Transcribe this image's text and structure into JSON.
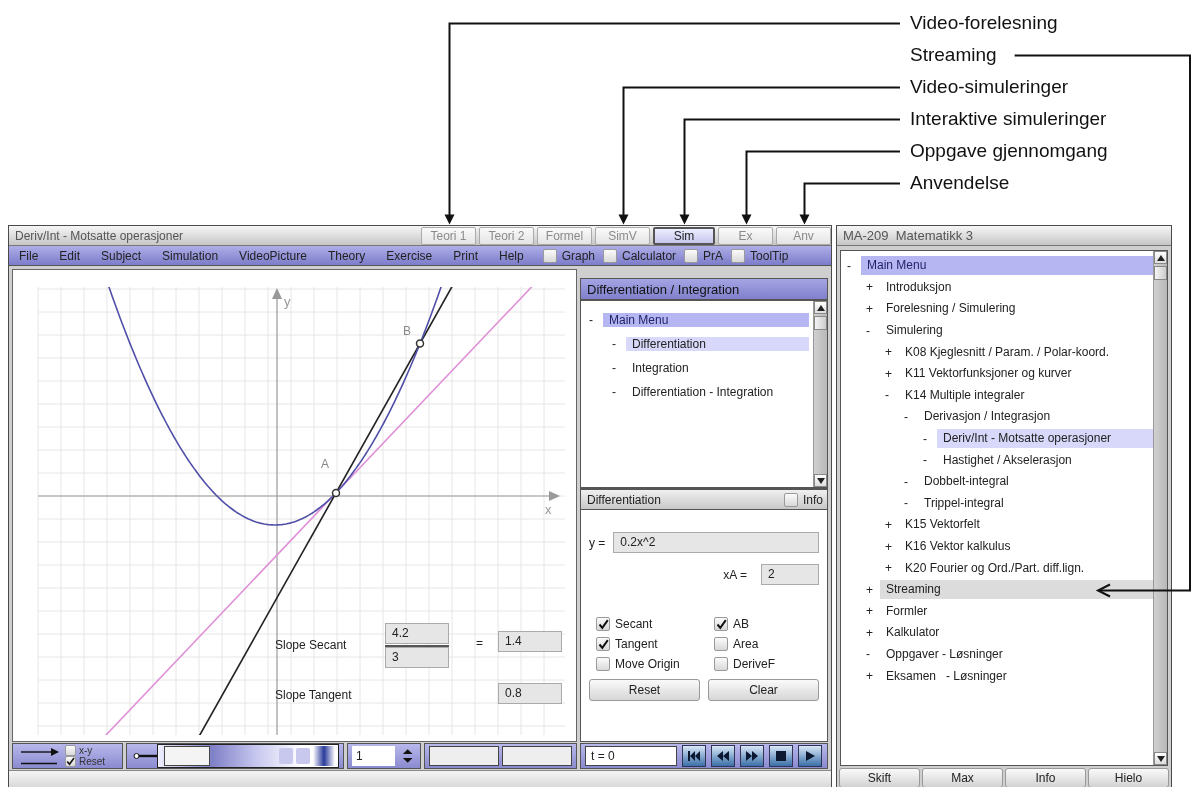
{
  "callouts": [
    {
      "label": "Video-forelesning",
      "kind": "tab"
    },
    {
      "label": "Streaming",
      "kind": "tree"
    },
    {
      "label": "Video-simuleringer",
      "kind": "tab"
    },
    {
      "label": "Interaktive simuleringer",
      "kind": "tab"
    },
    {
      "label": "Oppgave gjennomgang",
      "kind": "tab"
    },
    {
      "label": "Anvendelse",
      "kind": "tab"
    }
  ],
  "sim_window": {
    "title": "Deriv/Int - Motsatte operasjoner",
    "tabs": [
      {
        "label": "Teori 1",
        "selected": false,
        "disabled": true
      },
      {
        "label": "Teori 2",
        "selected": false,
        "disabled": true
      },
      {
        "label": "Formel",
        "selected": false,
        "disabled": true
      },
      {
        "label": "SimV",
        "selected": false,
        "disabled": true
      },
      {
        "label": "Sim",
        "selected": true,
        "disabled": false
      },
      {
        "label": "Ex",
        "selected": false,
        "disabled": true
      },
      {
        "label": "Anv",
        "selected": false,
        "disabled": true
      }
    ],
    "menu": [
      "File",
      "Edit",
      "Subject",
      "Simulation",
      "VideoPicture",
      "Theory",
      "Exercise",
      "Print",
      "Help"
    ],
    "menu_toggles": [
      {
        "label": "Graph",
        "checked": false
      },
      {
        "label": "Calculator",
        "checked": false
      },
      {
        "label": "PrA",
        "checked": false
      },
      {
        "label": "ToolTip",
        "checked": false
      }
    ],
    "graph": {
      "y_axis_label": "y",
      "x_axis_label": "x",
      "points": [
        {
          "label": "A"
        },
        {
          "label": "B"
        }
      ]
    },
    "slope": {
      "secant_label": "Slope Secant",
      "numerator": "4.2",
      "denominator": "3",
      "equals": "=",
      "secant_value": "1.4",
      "tangent_label": "Slope Tangent",
      "tangent_value": "0.8"
    },
    "nav_panel": {
      "title": "Differentiation / Integration",
      "tree": [
        {
          "marker": "-",
          "label": "Main Menu",
          "selected": true,
          "active": false,
          "hovered": false,
          "children": [
            {
              "marker": "-",
              "label": "Differentiation",
              "selected": false,
              "active": true,
              "hovered": false
            },
            {
              "marker": "-",
              "label": "Integration",
              "selected": false,
              "active": false,
              "hovered": false
            },
            {
              "marker": "-",
              "label": "Differentiation - Integration",
              "selected": false,
              "active": false,
              "hovered": false
            }
          ]
        }
      ]
    },
    "diff_panel": {
      "title": "Differentiation",
      "info": {
        "label": "Info",
        "checked": false
      },
      "function": {
        "label": "y =",
        "value": "0.2x^2"
      },
      "xa": {
        "label": "xA =",
        "value": "2"
      },
      "options": [
        {
          "label": "Secant",
          "checked": true
        },
        {
          "label": "AB",
          "checked": true
        },
        {
          "label": "Tangent",
          "checked": true
        },
        {
          "label": "Area",
          "checked": false
        },
        {
          "label": "Move Origin",
          "checked": false
        },
        {
          "label": "DeriveF",
          "checked": false
        }
      ],
      "buttons": [
        "Reset",
        "Clear"
      ]
    },
    "toolbar": {
      "toggles": [
        {
          "label": "x-y",
          "checked": false
        },
        {
          "label": "Reset",
          "checked": true
        }
      ],
      "slider": {
        "level": 0
      },
      "zoom_value": "1"
    },
    "player": {
      "time": "t = 0"
    }
  },
  "course_window": {
    "title": "MA-209  Matematikk 3",
    "tree": [
      {
        "marker": "-",
        "label": "Main Menu",
        "selected": true,
        "active": false,
        "hovered": false,
        "children": [
          {
            "marker": "+",
            "label": "Introduksjon",
            "selected": false,
            "active": false,
            "hovered": false
          },
          {
            "marker": "+",
            "label": "Forelesning / Simulering",
            "selected": false,
            "active": false,
            "hovered": false
          },
          {
            "marker": "-",
            "label": "Simulering",
            "selected": false,
            "active": false,
            "hovered": false,
            "children": [
              {
                "marker": "+",
                "label": "K08 Kjeglesnitt / Param. / Polar-koord.",
                "selected": false,
                "active": false,
                "hovered": false
              },
              {
                "marker": "+",
                "label": "K11 Vektorfunksjoner og kurver",
                "selected": false,
                "active": false,
                "hovered": false
              },
              {
                "marker": "-",
                "label": "K14 Multiple integraler",
                "selected": false,
                "active": false,
                "hovered": false,
                "children": [
                  {
                    "marker": "-",
                    "label": "Derivasjon / Integrasjon",
                    "selected": false,
                    "active": false,
                    "hovered": false,
                    "children": [
                      {
                        "marker": "-",
                        "label": "Deriv/Int - Motsatte operasjoner",
                        "selected": false,
                        "active": true,
                        "hovered": false
                      },
                      {
                        "marker": "-",
                        "label": "Hastighet / Akselerasjon",
                        "selected": false,
                        "active": false,
                        "hovered": false
                      }
                    ]
                  },
                  {
                    "marker": "-",
                    "label": "Dobbelt-integral",
                    "selected": false,
                    "active": false,
                    "hovered": false
                  },
                  {
                    "marker": "-",
                    "label": "Trippel-integral",
                    "selected": false,
                    "active": false,
                    "hovered": false
                  }
                ]
              },
              {
                "marker": "+",
                "label": "K15 Vektorfelt",
                "selected": false,
                "active": false,
                "hovered": false
              },
              {
                "marker": "+",
                "label": "K16 Vektor kalkulus",
                "selected": false,
                "active": false,
                "hovered": false
              },
              {
                "marker": "+",
                "label": "K20 Fourier og Ord./Part. diff.lign.",
                "selected": false,
                "active": false,
                "hovered": false
              }
            ]
          },
          {
            "marker": "+",
            "label": "Streaming",
            "selected": false,
            "active": false,
            "hovered": true
          },
          {
            "marker": "+",
            "label": "Formler",
            "selected": false,
            "active": false,
            "hovered": false
          },
          {
            "marker": "+",
            "label": "Kalkulator",
            "selected": false,
            "active": false,
            "hovered": false
          },
          {
            "marker": "-",
            "label": "Oppgaver - Løsninger",
            "selected": false,
            "active": false,
            "hovered": false
          },
          {
            "marker": "+",
            "label": "Eksamen   - Løsninger",
            "selected": false,
            "active": false,
            "hovered": false
          }
        ]
      }
    ],
    "buttons": [
      "Skift",
      "Max",
      "Info",
      "Hielo"
    ]
  }
}
